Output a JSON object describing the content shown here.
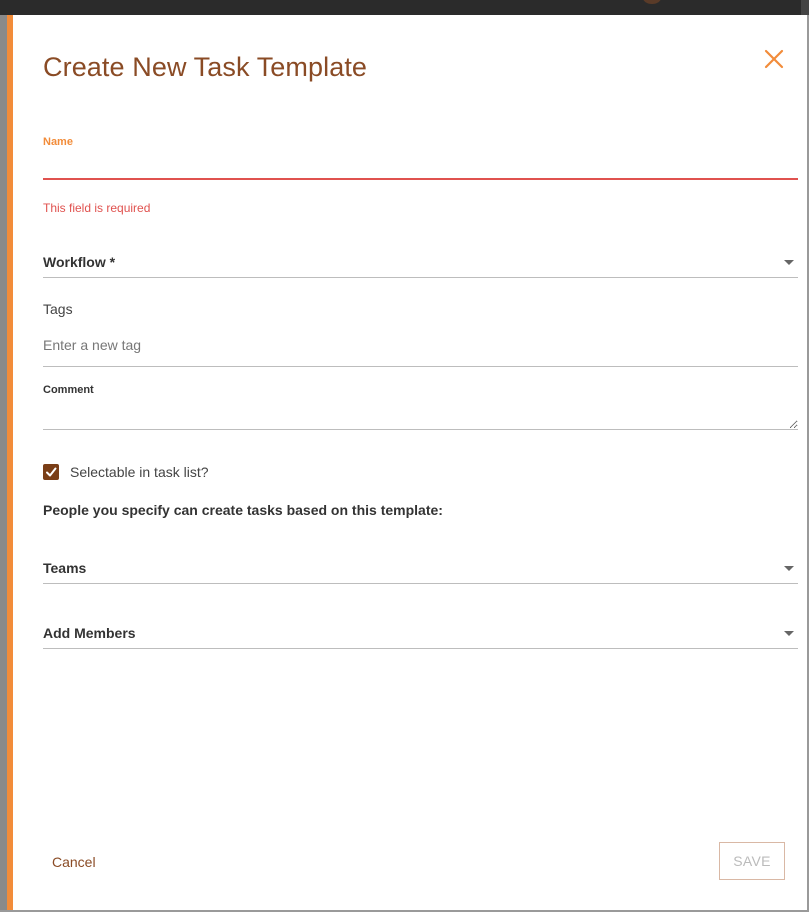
{
  "dialog": {
    "title": "Create New Task Template",
    "close_icon": "close-icon"
  },
  "fields": {
    "name": {
      "label": "Name",
      "value": "",
      "error": "This field is required"
    },
    "workflow": {
      "label": "Workflow *"
    },
    "tags": {
      "label": "Tags",
      "placeholder": "Enter a new tag"
    },
    "comment": {
      "label": "Comment",
      "value": ""
    },
    "selectable": {
      "label": "Selectable in task list?",
      "checked": true
    },
    "people_text": "People you specify can create tasks based on this template:",
    "teams": {
      "label": "Teams"
    },
    "members": {
      "label": "Add Members"
    }
  },
  "actions": {
    "cancel_label": "Cancel",
    "save_label": "SAVE"
  },
  "colors": {
    "accent": "#f28c3a",
    "title": "#8a4b25",
    "error": "#e0524f",
    "checkbox": "#7a3e17"
  }
}
